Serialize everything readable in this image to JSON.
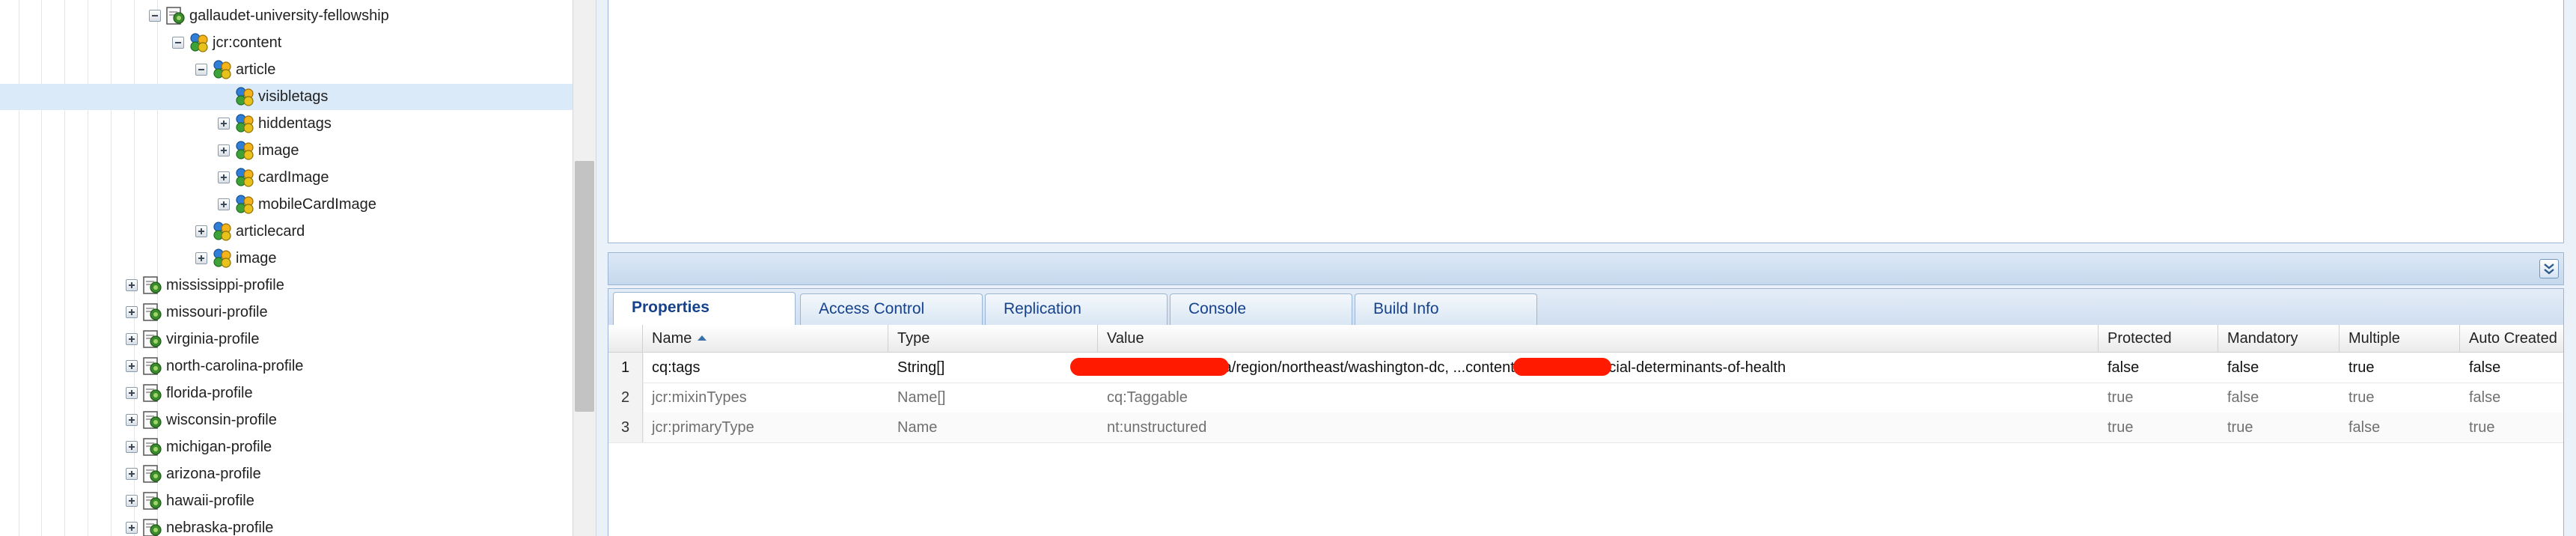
{
  "tree": {
    "nodes": [
      {
        "label": "gallaudet-university-fellowship",
        "expander": "minus",
        "icon": "page-icon"
      },
      {
        "label": "jcr:content",
        "expander": "minus",
        "icon": "node-icon"
      },
      {
        "label": "article",
        "expander": "minus",
        "icon": "node-icon"
      },
      {
        "label": "visibletags",
        "expander": "none",
        "icon": "node-icon",
        "selected": true
      },
      {
        "label": "hiddentags",
        "expander": "plus",
        "icon": "node-icon"
      },
      {
        "label": "image",
        "expander": "plus",
        "icon": "node-icon"
      },
      {
        "label": "cardImage",
        "expander": "plus",
        "icon": "node-icon"
      },
      {
        "label": "mobileCardImage",
        "expander": "plus",
        "icon": "node-icon"
      },
      {
        "label": "articlecard",
        "expander": "plus",
        "icon": "node-icon"
      },
      {
        "label": "image",
        "expander": "plus",
        "icon": "node-icon"
      },
      {
        "label": "mississippi-profile",
        "expander": "plus",
        "icon": "page-icon"
      },
      {
        "label": "missouri-profile",
        "expander": "plus",
        "icon": "page-icon"
      },
      {
        "label": "virginia-profile",
        "expander": "plus",
        "icon": "page-icon"
      },
      {
        "label": "north-carolina-profile",
        "expander": "plus",
        "icon": "page-icon"
      },
      {
        "label": "florida-profile",
        "expander": "plus",
        "icon": "page-icon"
      },
      {
        "label": "wisconsin-profile",
        "expander": "plus",
        "icon": "page-icon"
      },
      {
        "label": "michigan-profile",
        "expander": "plus",
        "icon": "page-icon"
      },
      {
        "label": "arizona-profile",
        "expander": "plus",
        "icon": "page-icon"
      },
      {
        "label": "hawaii-profile",
        "expander": "plus",
        "icon": "page-icon"
      },
      {
        "label": "nebraska-profile",
        "expander": "plus",
        "icon": "page-icon"
      }
    ]
  },
  "tabs": [
    {
      "label": "Properties",
      "active": true
    },
    {
      "label": "Access Control"
    },
    {
      "label": "Replication"
    },
    {
      "label": "Console"
    },
    {
      "label": "Build Info"
    }
  ],
  "grid": {
    "columns": [
      "Name",
      "Type",
      "Value",
      "Protected",
      "Mandatory",
      "Multiple",
      "Auto Created"
    ],
    "rows": [
      {
        "num": "1",
        "name": "cq:tags",
        "type": "String[]",
        "value": "...ate:content-meta/region/northeast/washington-dc, ...content-meta/topic/social-determinants-of-health",
        "protected": "false",
        "mandatory": "false",
        "multiple": "true",
        "auto_created": "false"
      },
      {
        "num": "2",
        "name": "jcr:mixinTypes",
        "type": "Name[]",
        "value": "cq:Taggable",
        "protected": "true",
        "mandatory": "false",
        "multiple": "true",
        "auto_created": "false"
      },
      {
        "num": "3",
        "name": "jcr:primaryType",
        "type": "Name",
        "value": "nt:unstructured",
        "protected": "true",
        "mandatory": "true",
        "multiple": "false",
        "auto_created": "true"
      }
    ]
  },
  "colors": {
    "selected_row": "#dbeaf8",
    "tab_text": "#15428b",
    "redaction": "#ff1a00"
  }
}
